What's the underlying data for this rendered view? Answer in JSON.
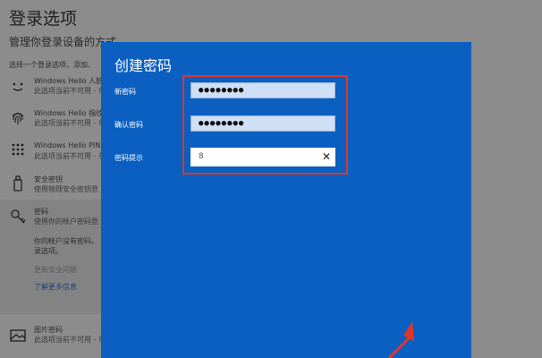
{
  "background": {
    "title": "登录选项",
    "subtitle": "管理你登录设备的方式",
    "hint": "选择一个登录选项，添加、",
    "options": [
      {
        "icon": "face-icon",
        "title": "Windows Hello 人脸",
        "desc": "此选项当前不可用 - 单"
      },
      {
        "icon": "fingerprint-icon",
        "title": "Windows Hello 指纹",
        "desc": "此选项当前不可用 - 单"
      },
      {
        "icon": "pin-keypad-icon",
        "title": "Windows Hello PIN",
        "desc": "此选项当前不可用 - 单"
      },
      {
        "icon": "security-key-icon",
        "title": "安全密钥",
        "desc": "使用物理安全密钥登"
      },
      {
        "icon": "key-icon",
        "title": "密码",
        "desc": "使用你的帐户密码登"
      }
    ],
    "expanded": {
      "line1": "你的帐户没有密码。",
      "line2": "录选项。",
      "disabled_link": "更新安全问题",
      "learn_more": "了解更多信息"
    },
    "picture_password": {
      "icon": "picture-icon",
      "title": "图片密码",
      "desc": "此选项当前不可用 - 单"
    }
  },
  "dialog": {
    "title": "创建密码",
    "fields": [
      {
        "label": "新密码",
        "value": "●●●●●●●●"
      },
      {
        "label": "确认密码",
        "value": "●●●●●●●●"
      },
      {
        "label": "密码提示",
        "value": "8"
      }
    ],
    "clear_icon": "close-icon",
    "accent_color": "#0a5fc0",
    "highlight_color": "#e0352b"
  }
}
